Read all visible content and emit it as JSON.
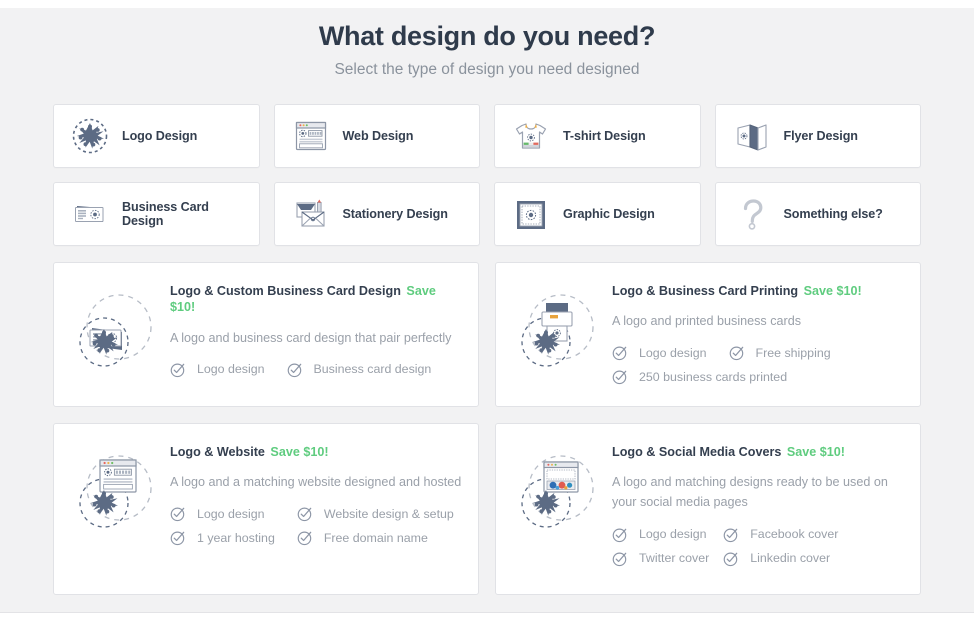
{
  "header": {
    "title": "What design do you need?",
    "subtitle": "Select the type of design you need designed"
  },
  "colors": {
    "background": "#f2f2f3",
    "card_background": "#ffffff",
    "card_border": "#e1e2e6",
    "title_text": "#2f3b4b",
    "muted_text": "#9aa0a9",
    "save_green": "#5fcc7f",
    "icon_slate": "#5c6b84"
  },
  "categories": [
    {
      "label": "Logo Design",
      "icon": "logo-starburst-icon"
    },
    {
      "label": "Web Design",
      "icon": "browser-window-icon"
    },
    {
      "label": "T-shirt Design",
      "icon": "tshirt-icon"
    },
    {
      "label": "Flyer Design",
      "icon": "flyer-folded-icon"
    },
    {
      "label": "Business Card Design",
      "icon": "business-cards-icon"
    },
    {
      "label": "Stationery Design",
      "icon": "envelope-stationery-icon"
    },
    {
      "label": "Graphic Design",
      "icon": "framed-graphic-icon"
    },
    {
      "label": "Something else?",
      "icon": "question-mark-icon"
    }
  ],
  "bundles": [
    {
      "title": "Logo & Custom Business Card Design",
      "save": "Save $10!",
      "description": "A logo and business card design that pair perfectly",
      "icon": "logo-plus-business-card-icon",
      "features": [
        "Logo design",
        "Business card design"
      ],
      "feature_rows": 1
    },
    {
      "title": "Logo & Business Card Printing",
      "save": "Save $10!",
      "description": "A logo and printed business cards",
      "icon": "logo-plus-printer-icon",
      "features": [
        "Logo design",
        "Free shipping",
        "250 business cards printed"
      ],
      "feature_rows": 2
    },
    {
      "title": "Logo & Website",
      "save": "Save $10!",
      "description": "A logo and a matching website designed and hosted",
      "icon": "logo-plus-website-icon",
      "features": [
        "Logo design",
        "Website design & setup",
        "1 year hosting",
        "Free domain name"
      ],
      "feature_rows": 2
    },
    {
      "title": "Logo & Social Media Covers",
      "save": "Save $10!",
      "description": "A logo and matching designs ready to be used on your social media pages",
      "icon": "logo-plus-social-icon",
      "features": [
        "Logo design",
        "Facebook cover",
        "Twitter cover",
        "Linkedin cover"
      ],
      "feature_rows": 2
    }
  ]
}
